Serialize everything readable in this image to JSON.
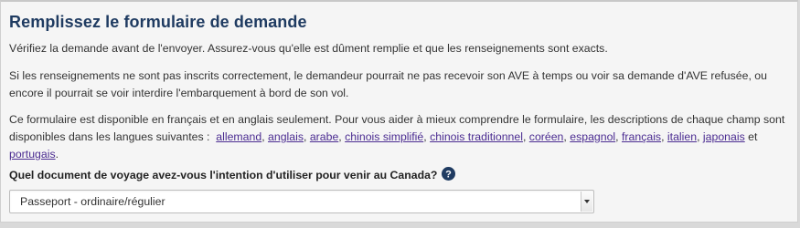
{
  "form": {
    "title": "Remplissez le formulaire de demande",
    "intro": "Vérifiez la demande avant de l'envoyer. Assurez-vous qu'elle est dûment remplie et que les renseignements sont exacts.",
    "warning": "Si les renseignements ne sont pas inscrits correctement, le demandeur pourrait ne pas recevoir son AVE à temps ou voir sa demande d'AVE refusée, ou encore il pourrait se voir interdire l'embarquement à bord de son vol.",
    "languages_intro": "Ce formulaire est disponible en français et en anglais seulement. Pour vous aider à mieux comprendre le formulaire, les descriptions de chaque champ sont disponibles dans les langues suivantes :",
    "languages": [
      "allemand",
      "anglais",
      "arabe",
      "chinois simplifié",
      "chinois traditionnel",
      "coréen",
      "espagnol",
      "français",
      "italien",
      "japonais",
      "portugais"
    ],
    "languages_conjunction": "et",
    "languages_end": ".",
    "question": "Quel document de voyage avez-vous l'intention d'utiliser pour venir au Canada?",
    "help_icon": "question-circle-icon",
    "document_select": {
      "value": "Passeport - ordinaire/régulier"
    }
  },
  "colors": {
    "title": "#1f3b61",
    "link": "#4b2c91",
    "help_icon": "#1f3b61"
  }
}
